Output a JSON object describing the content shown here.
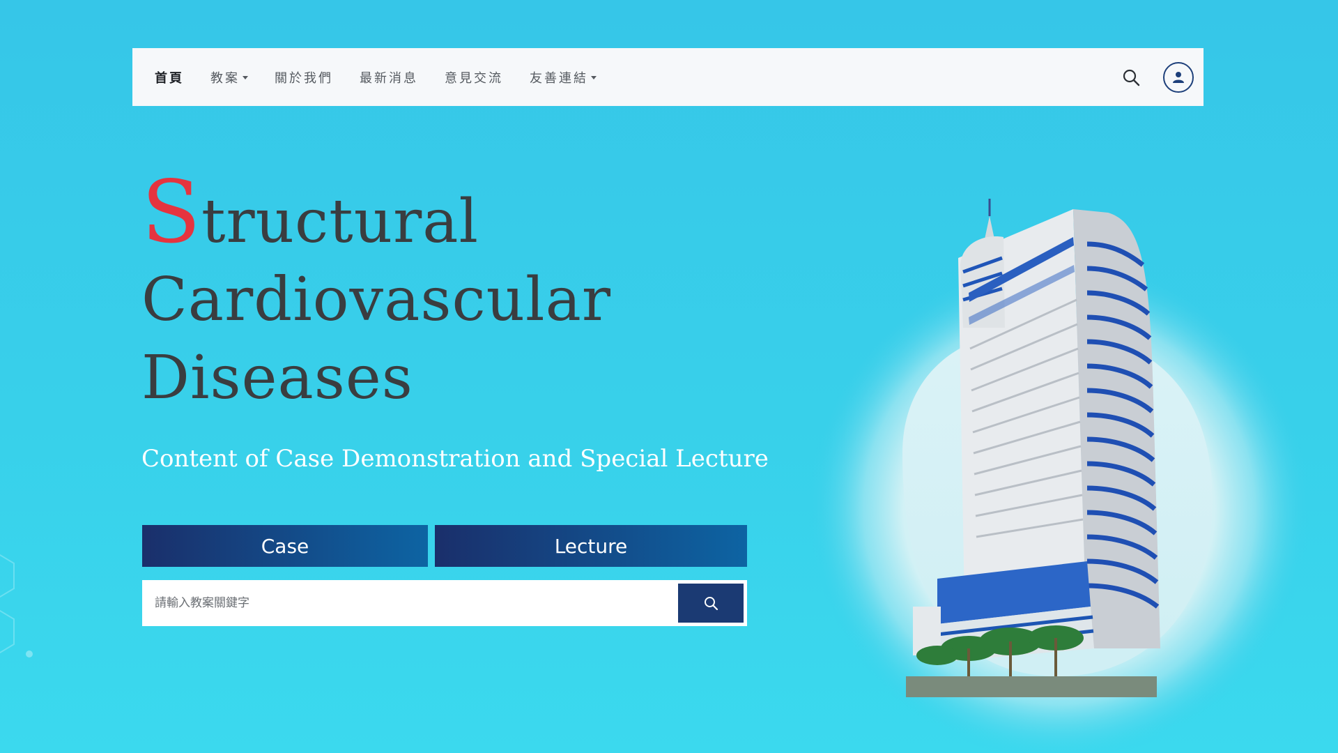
{
  "nav": {
    "items": [
      {
        "label": "首頁",
        "active": true,
        "dropdown": false
      },
      {
        "label": "教案",
        "active": false,
        "dropdown": true
      },
      {
        "label": "關於我們",
        "active": false,
        "dropdown": false
      },
      {
        "label": "最新消息",
        "active": false,
        "dropdown": false
      },
      {
        "label": "意見交流",
        "active": false,
        "dropdown": false
      },
      {
        "label": "友善連結",
        "active": false,
        "dropdown": true
      }
    ],
    "search_icon": "search-icon",
    "user_icon": "user-icon"
  },
  "hero": {
    "title_first_letter": "S",
    "title_line1_rest": "tructural",
    "title_line2": "Cardiovascular",
    "title_line3": "Diseases",
    "subtitle": "Content of Case Demonstration and Special Lecture",
    "accent_color": "#e5343f"
  },
  "buttons": {
    "case_label": "Case",
    "lecture_label": "Lecture"
  },
  "search": {
    "placeholder": "請輸入教案關鍵字",
    "value": ""
  },
  "colors": {
    "background": "#38cdea",
    "button_dark": "#1a2f6b",
    "button_light": "#0d64a3",
    "navbar": "#f6f8fa"
  }
}
